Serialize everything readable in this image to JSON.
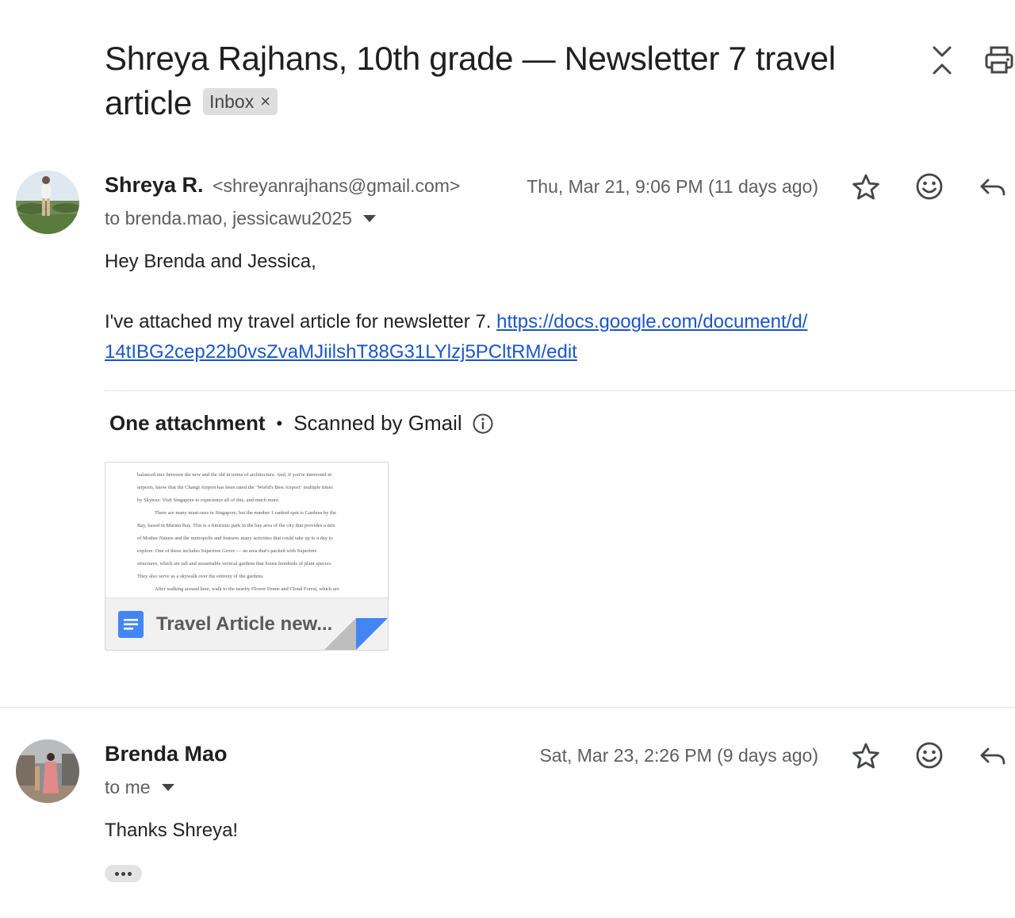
{
  "thread": {
    "subject": "Shreya Rajhans, 10th grade — Newsletter 7 travel article",
    "label_chip": "Inbox",
    "label_remove": "×"
  },
  "messages": [
    {
      "sender_name": "Shreya R.",
      "sender_email": "<shreyanrajhans@gmail.com>",
      "to": "to brenda.mao, jessicawu2025",
      "date": "Thu, Mar 21, 9:06 PM (11 days ago)",
      "greeting": "Hey Brenda and Jessica,",
      "body_text": "I've attached my travel article for newsletter 7.",
      "link_text": "https://docs.google.com/document/d/14tIBG2cep22b0vsZvaMJiilshT88G31LYlzj5PCltRM/edit",
      "link_line1": "https://docs.google.com/document/d/",
      "link_line2": "14tIBG2cep22b0vsZvaMJiilshT88G31LYlzj5PCltRM/edit",
      "attachments": {
        "heading": "One attachment",
        "separator": "•",
        "scanned": "Scanned by Gmail",
        "file_name": "Travel Article new...",
        "preview_lines": [
          "balanced mix between the new and the old in terms of architecture. And, if you're interested in",
          "airports, know that the Changi Airport has been rated the \"World's Best Airport\" multiple times",
          "by Skytrax. Visit Singapore to experience all of this, and much more.",
          "There are many must-sees in Singapore, but the number 1 ranked spot is Gardens by the",
          "Bay, based in Marina Bay. This is a futuristic park in the bay area of the city that provides a mix",
          "of Mother Nature and the metropolis and features many activities that could take up to a day to",
          "explore. One of these includes Supertree Grove — an area that's packed with Supertree",
          "structures, which are tall and sustainable vertical gardens that house hundreds of plant species.",
          "They also serve as a skywalk over the entirety of the gardens.",
          "After walking around here, walk to the nearby Flower Dome and Cloud Forest, which are"
        ]
      }
    },
    {
      "sender_name": "Brenda Mao",
      "to": "to me",
      "date": "Sat, Mar 23, 2:26 PM (9 days ago)",
      "body_text": "Thanks Shreya!"
    }
  ],
  "colors": {
    "link": "#1a56c8",
    "doc_icon": "#4285f4",
    "chip_bg": "#dedede"
  },
  "icons": {
    "collapse": "collapse-all-icon",
    "print": "print-icon",
    "star": "star-icon",
    "emoji": "emoji-reaction-icon",
    "reply": "reply-icon",
    "info": "info-icon",
    "doc": "google-docs-icon"
  }
}
